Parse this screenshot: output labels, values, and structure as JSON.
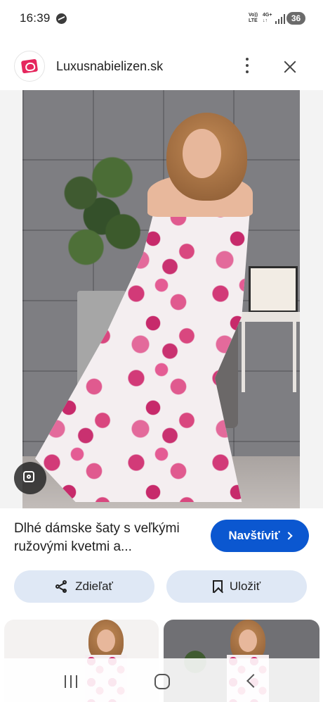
{
  "status_bar": {
    "time": "16:39",
    "network_top": "Vo))",
    "network_bottom": "LTE",
    "g4_top": "4G+",
    "g4_bottom": "↓↑",
    "battery": "36",
    "icons": [
      "messenger-icon",
      "signal-icon",
      "battery-icon"
    ]
  },
  "source": {
    "name": "Luxusnabielizen.sk",
    "logo_color": "#e5265d",
    "icons": [
      "more-vert-icon",
      "close-icon"
    ]
  },
  "image": {
    "lens_icon": "google-lens-icon"
  },
  "product": {
    "title": "Dlhé dámske šaty s veľkými ružovými kvetmi a...",
    "visit_label": "Navštíviť",
    "visit_color": "#0b57d0"
  },
  "actions": {
    "share_label": "Zdieľať",
    "save_label": "Uložiť",
    "button_color": "#dfe8f5"
  },
  "related": {
    "thumbnails": [
      "related-thumbnail-1",
      "related-thumbnail-2"
    ]
  },
  "nav": {
    "icons": [
      "recents-icon",
      "home-icon",
      "back-icon"
    ]
  }
}
